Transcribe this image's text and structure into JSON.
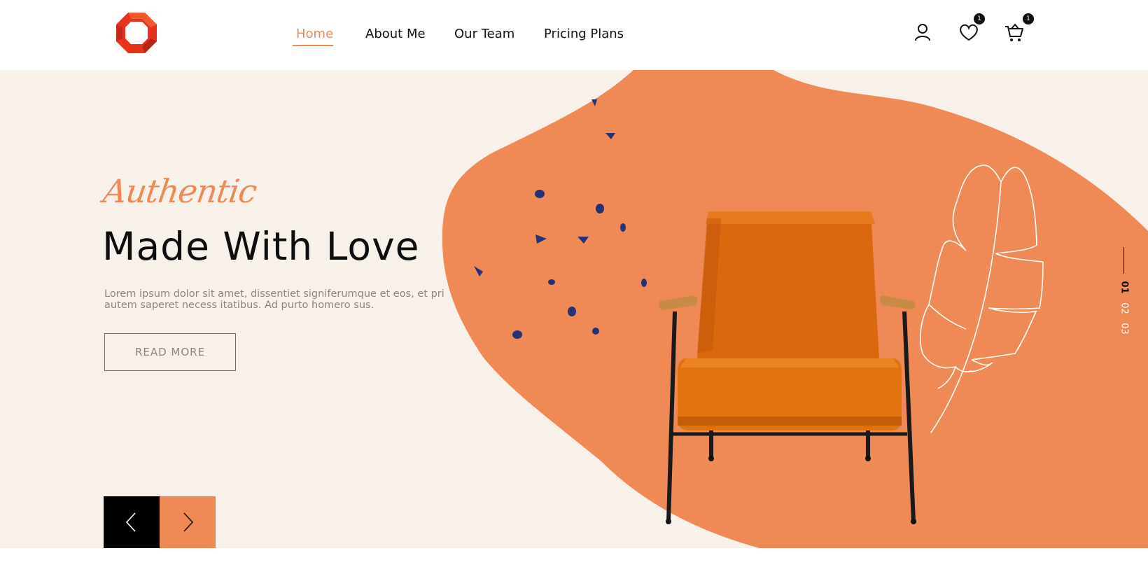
{
  "brand": {
    "logo_icon": "octagon-ring-logo-icon",
    "colors": {
      "primary": "#ef8a57",
      "dark": "#000000",
      "logo_red": "#e8321b"
    }
  },
  "nav": {
    "items": [
      {
        "label": "Home",
        "active": true
      },
      {
        "label": "About Me",
        "active": false
      },
      {
        "label": "Our Team",
        "active": false
      },
      {
        "label": "Pricing Plans",
        "active": false
      }
    ]
  },
  "header_icons": {
    "account": {
      "icon": "user-icon"
    },
    "wishlist": {
      "icon": "heart-icon",
      "badge": "1"
    },
    "cart": {
      "icon": "cart-icon",
      "badge": "1"
    }
  },
  "hero": {
    "eyebrow": "Authentic",
    "headline": "Made With Love",
    "description": "Lorem ipsum dolor sit amet, dissentiet signiferumque et eos, et pri autem saperet necess itatibus. Ad purto homero sus.",
    "cta_label": "READ MORE",
    "prev_icon": "chevron-left-icon",
    "next_icon": "chevron-right-icon",
    "slides": [
      "01",
      "02",
      "03"
    ]
  }
}
